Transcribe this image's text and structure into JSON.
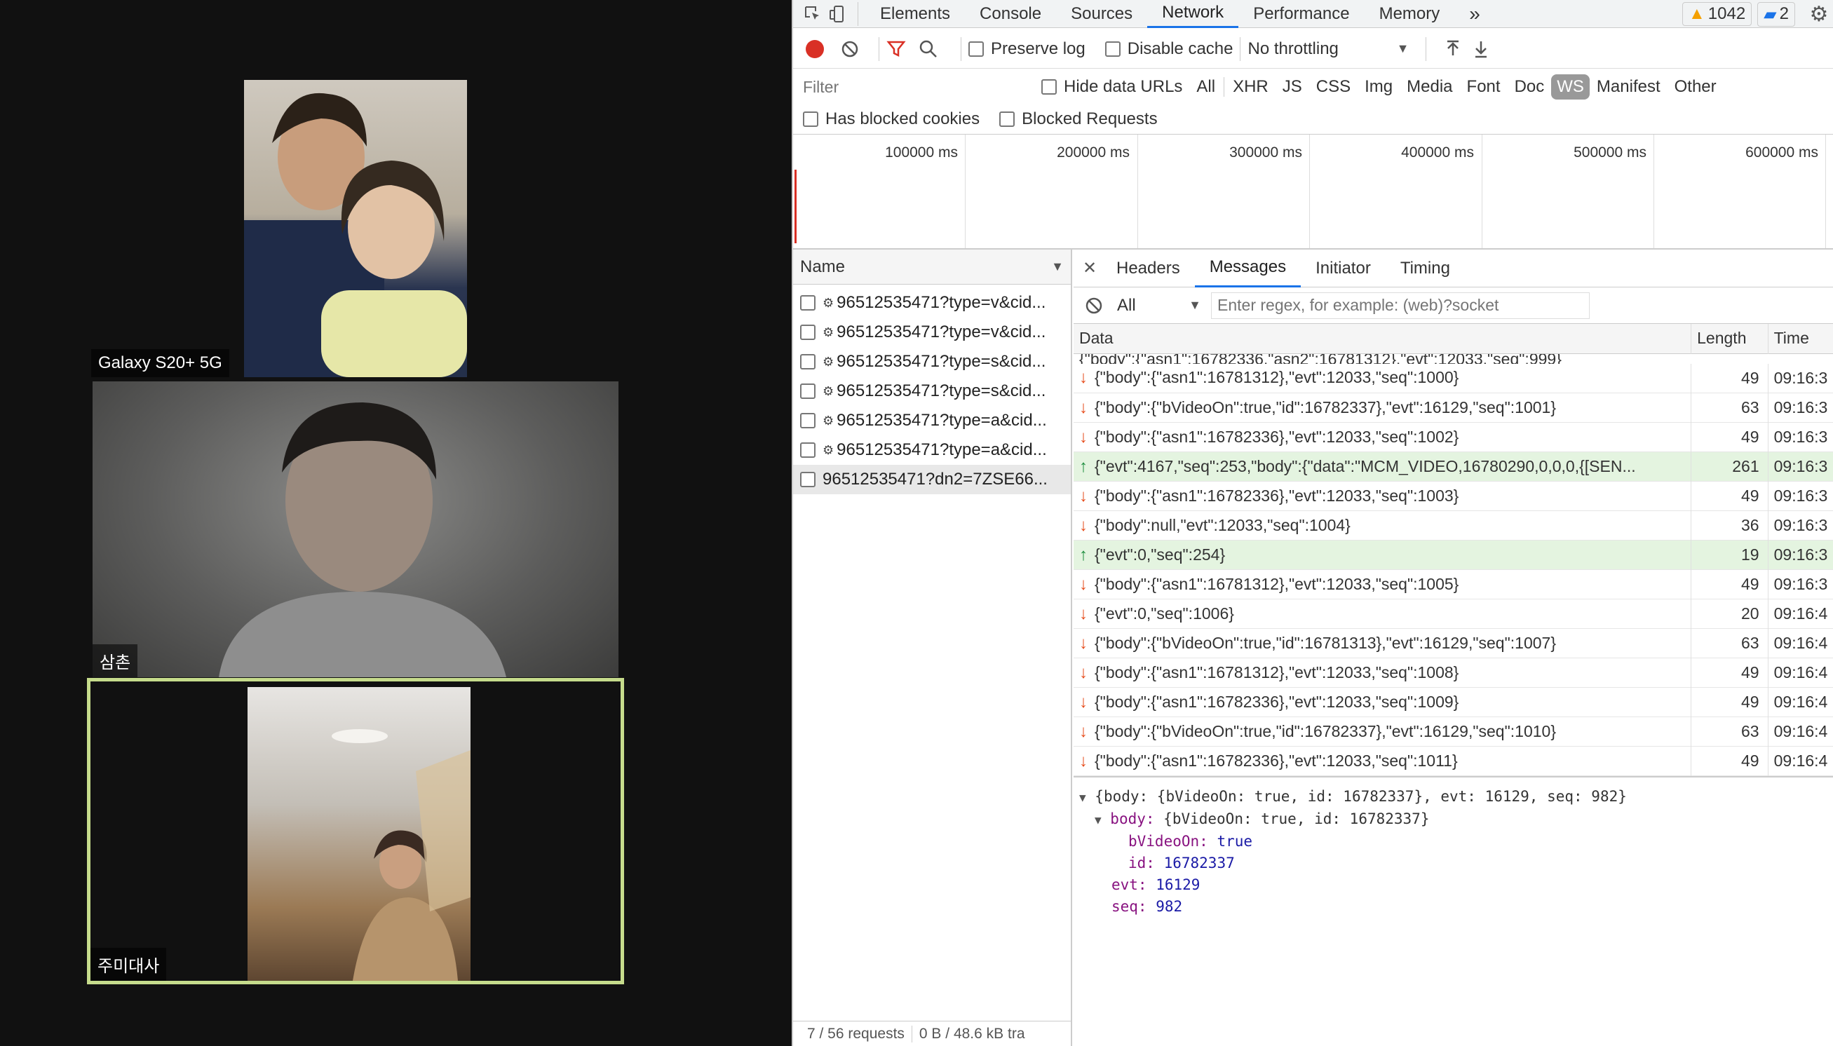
{
  "participants": [
    {
      "name": "Galaxy S20+ 5G"
    },
    {
      "name": "삼촌"
    },
    {
      "name": "주미대사"
    }
  ],
  "devtools": {
    "main_tabs": [
      "Elements",
      "Console",
      "Sources",
      "Network",
      "Performance",
      "Memory"
    ],
    "more_tabs_glyph": "»",
    "selected_tab": "Network",
    "warn_count": "1042",
    "msg_count": "2",
    "toolbar": {
      "preserve_log": "Preserve log",
      "disable_cache": "Disable cache",
      "throttling": "No throttling"
    },
    "filter": {
      "placeholder": "Filter",
      "hide_data_urls": "Hide data URLs",
      "types": [
        "All",
        "XHR",
        "JS",
        "CSS",
        "Img",
        "Media",
        "Font",
        "Doc",
        "WS",
        "Manifest",
        "Other"
      ],
      "selected_type": "WS",
      "has_blocked_cookies": "Has blocked cookies",
      "blocked_requests": "Blocked Requests"
    },
    "timeline_labels": [
      "100000 ms",
      "200000 ms",
      "300000 ms",
      "400000 ms",
      "500000 ms",
      "600000 ms"
    ],
    "name_header": "Name",
    "requests": [
      "96512535471?type=v&cid...",
      "96512535471?type=v&cid...",
      "96512535471?type=s&cid...",
      "96512535471?type=s&cid...",
      "96512535471?type=a&cid...",
      "96512535471?type=a&cid...",
      "96512535471?dn2=7ZSE66..."
    ],
    "status_footer": "7 / 56 requests",
    "transfer_footer": "0 B / 48.6 kB tra",
    "detail_tabs": [
      "Headers",
      "Messages",
      "Initiator",
      "Timing"
    ],
    "selected_detail_tab": "Messages",
    "message_filter": {
      "type": "All",
      "placeholder": "Enter regex, for example: (web)?socket"
    },
    "columns": {
      "data": "Data",
      "length": "Length",
      "time": "Time"
    },
    "partial_row": "{\"body\":{\"asn1\":16782336,\"asn2\":16781312},\"evt\":12033,\"seq\":999}",
    "messages": [
      {
        "dir": "down",
        "data": "{\"body\":{\"asn1\":16781312},\"evt\":12033,\"seq\":1000}",
        "length": "49",
        "time": "09:16:3"
      },
      {
        "dir": "down",
        "data": "{\"body\":{\"bVideoOn\":true,\"id\":16782337},\"evt\":16129,\"seq\":1001}",
        "length": "63",
        "time": "09:16:3"
      },
      {
        "dir": "down",
        "data": "{\"body\":{\"asn1\":16782336},\"evt\":12033,\"seq\":1002}",
        "length": "49",
        "time": "09:16:3"
      },
      {
        "dir": "up",
        "data": "{\"evt\":4167,\"seq\":253,\"body\":{\"data\":\"MCM_VIDEO,16780290,0,0,0,{[SEN...",
        "length": "261",
        "time": "09:16:3"
      },
      {
        "dir": "down",
        "data": "{\"body\":{\"asn1\":16782336},\"evt\":12033,\"seq\":1003}",
        "length": "49",
        "time": "09:16:3"
      },
      {
        "dir": "down",
        "data": "{\"body\":null,\"evt\":12033,\"seq\":1004}",
        "length": "36",
        "time": "09:16:3"
      },
      {
        "dir": "up",
        "data": "{\"evt\":0,\"seq\":254}",
        "length": "19",
        "time": "09:16:3"
      },
      {
        "dir": "down",
        "data": "{\"body\":{\"asn1\":16781312},\"evt\":12033,\"seq\":1005}",
        "length": "49",
        "time": "09:16:3"
      },
      {
        "dir": "down",
        "data": "{\"evt\":0,\"seq\":1006}",
        "length": "20",
        "time": "09:16:4"
      },
      {
        "dir": "down",
        "data": "{\"body\":{\"bVideoOn\":true,\"id\":16781313},\"evt\":16129,\"seq\":1007}",
        "length": "63",
        "time": "09:16:4"
      },
      {
        "dir": "down",
        "data": "{\"body\":{\"asn1\":16781312},\"evt\":12033,\"seq\":1008}",
        "length": "49",
        "time": "09:16:4"
      },
      {
        "dir": "down",
        "data": "{\"body\":{\"asn1\":16782336},\"evt\":12033,\"seq\":1009}",
        "length": "49",
        "time": "09:16:4"
      },
      {
        "dir": "down",
        "data": "{\"body\":{\"bVideoOn\":true,\"id\":16782337},\"evt\":16129,\"seq\":1010}",
        "length": "63",
        "time": "09:16:4"
      },
      {
        "dir": "down",
        "data": "{\"body\":{\"asn1\":16782336},\"evt\":12033,\"seq\":1011}",
        "length": "49",
        "time": "09:16:4"
      }
    ],
    "preview": {
      "summary": "{body: {bVideoOn: true, id: 16782337}, evt: 16129, seq: 982}",
      "body_key": "body:",
      "body_summary": "{bVideoOn: true, id: 16782337}",
      "bvideo_key": "bVideoOn:",
      "bvideo_val": "true",
      "id_key": "id:",
      "id_val": "16782337",
      "evt_key": "evt:",
      "evt_val": "16129",
      "seq_key": "seq:",
      "seq_val": "982"
    }
  }
}
